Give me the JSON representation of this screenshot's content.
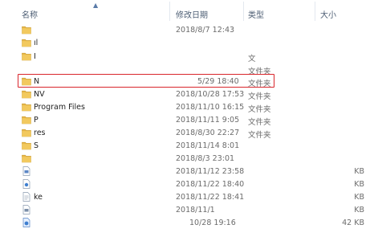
{
  "columns": {
    "name": "名称",
    "date": "修改日期",
    "type": "类型",
    "size": "大小"
  },
  "rows": [
    {
      "kind": "folder",
      "name": "",
      "date": "2018/8/7 12:43",
      "type": "",
      "size": ""
    },
    {
      "kind": "folder",
      "name": "ıl",
      "date": "",
      "type": "",
      "size": ""
    },
    {
      "kind": "folder",
      "name": "I",
      "date": "",
      "type": "文",
      "size": ""
    },
    {
      "kind": "folder",
      "name": "",
      "date": "",
      "type": "文件夹",
      "size": ""
    },
    {
      "kind": "folder",
      "name": "N",
      "date": "5/29 18:40",
      "type": "文件夹",
      "size": ""
    },
    {
      "kind": "folder",
      "name": "NV",
      "date": "2018/10/28 17:53",
      "type": "文件夹",
      "size": ""
    },
    {
      "kind": "folder",
      "name": "Program Files",
      "date": "2018/11/10 16:15",
      "type": "文件夹",
      "size": ""
    },
    {
      "kind": "folder",
      "name": "P",
      "date": "2018/11/11 9:05",
      "type": "文件夹",
      "size": ""
    },
    {
      "kind": "folder",
      "name": "res",
      "date": "2018/8/30 22:27",
      "type": "文件夹",
      "size": ""
    },
    {
      "kind": "folder",
      "name": "S",
      "date": "2018/11/14 8:01",
      "type": "",
      "size": ""
    },
    {
      "kind": "folder",
      "name": "",
      "date": "2018/8/3 23:01",
      "type": "",
      "size": ""
    },
    {
      "kind": "file",
      "name": "",
      "date": "2018/11/12 23:58",
      "type": "",
      "size": "KB"
    },
    {
      "kind": "file",
      "name": "",
      "date": "2018/11/22 18:40",
      "type": "",
      "size": "KB"
    },
    {
      "kind": "file",
      "name": "ke",
      "date": "2018/11/22 18:41",
      "type": "",
      "size": "KB"
    },
    {
      "kind": "file",
      "name": "",
      "date": "2018/11/1",
      "type": "",
      "size": "KB"
    },
    {
      "kind": "file",
      "name": "",
      "date": "10/28 19:16",
      "type": "",
      "size": "42 KB"
    }
  ],
  "highlighted_row": "Program Files",
  "colors": {
    "header_text": "#4c5d73",
    "folder": "#e8b84a",
    "highlight_border": "#d9262c"
  }
}
